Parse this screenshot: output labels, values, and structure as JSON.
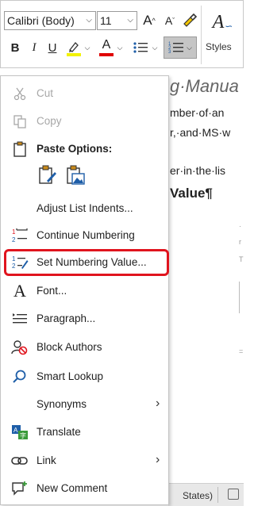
{
  "document": {
    "line1": "g·Manua",
    "line2": "mber·of·an",
    "line3": "r,·and·MS·w",
    "line4": "er·in·the·lis",
    "line5": "Value¶",
    "status_text": "States)"
  },
  "toolbar": {
    "font_name": "Calibri (Body)",
    "font_size": "11",
    "grow_font": "A",
    "shrink_font": "A",
    "bold": "B",
    "italic": "I",
    "underline": "U",
    "font_color": "A",
    "styles_label": "Styles",
    "highlight_color": "#f2f200",
    "font_color_value": "#e00000"
  },
  "menu": {
    "cut": "Cut",
    "copy": "Copy",
    "paste_options": "Paste Options:",
    "adjust_list_indents": "Adjust List Indents...",
    "continue_numbering": "Continue Numbering",
    "set_numbering_value": "Set Numbering Value...",
    "font": "Font...",
    "paragraph": "Paragraph...",
    "block_authors": "Block Authors",
    "smart_lookup": "Smart Lookup",
    "synonyms": "Synonyms",
    "translate": "Translate",
    "link": "Link",
    "new_comment": "New Comment"
  },
  "highlight": {
    "color": "#e0141e",
    "target": "set_numbering_value"
  }
}
